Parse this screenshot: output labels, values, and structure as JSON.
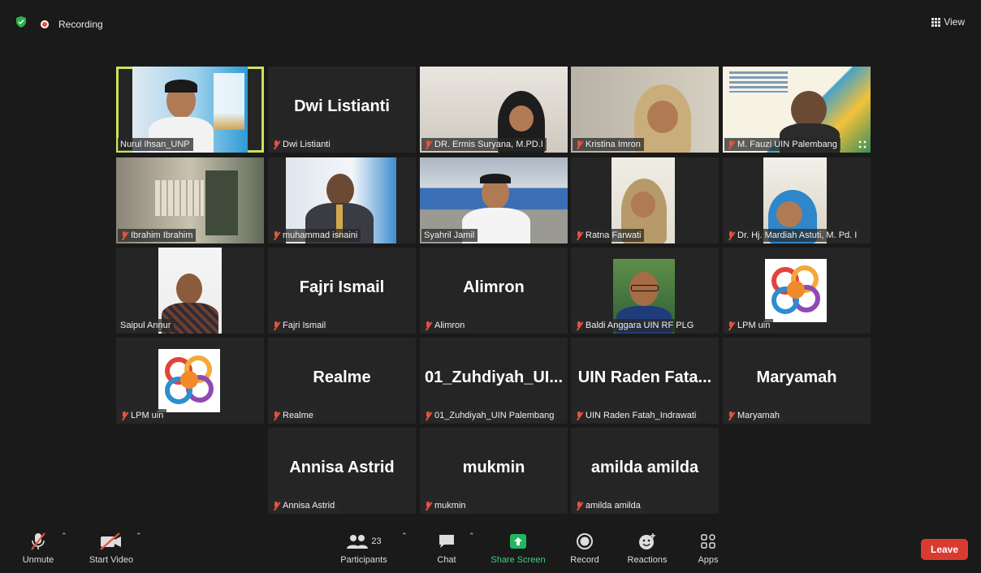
{
  "topbar": {
    "recording_label": "Recording",
    "view_label": "View"
  },
  "colors": {
    "active_speaker": "#c8e65a",
    "leave": "#d93b30",
    "share": "#3dd17f",
    "muted": "#e5533d"
  },
  "tiles": [
    {
      "name": "Nurul Ihsan_UNP",
      "big": "",
      "video": "banner",
      "muted": false
    },
    {
      "name": "Dwi Listianti",
      "big": "Dwi Listianti",
      "muted": true
    },
    {
      "name": "DR. Ermis Suryana, M.PD.I",
      "big": "",
      "video": "hijab-office",
      "muted": true
    },
    {
      "name": "Kristina Imron",
      "big": "",
      "video": "hijab-room",
      "muted": true
    },
    {
      "name": "M. Fauzi UIN Palembang",
      "big": "",
      "video": "poster",
      "muted": true
    },
    {
      "name": "Ibrahim Ibrahim",
      "big": "",
      "video": "office",
      "muted": true
    },
    {
      "name": "muhammad isnaini",
      "big": "",
      "video": "suit",
      "muted": true
    },
    {
      "name": "Syahril Jamil",
      "big": "",
      "video": "outdoor",
      "muted": false
    },
    {
      "name": "Ratna Farwati",
      "big": "",
      "video": "hijab-portrait",
      "muted": true
    },
    {
      "name": "Dr. Hj. Mardiah Astuti, M. Pd. I",
      "big": "",
      "video": "hijab-blue",
      "muted": true
    },
    {
      "name": "Saipul Annur",
      "big": "",
      "video": "batik",
      "muted": false
    },
    {
      "name": "Fajri Ismail",
      "big": "Fajri Ismail",
      "muted": true
    },
    {
      "name": "Alimron",
      "big": "Alimron",
      "muted": true
    },
    {
      "name": "Baldi Anggara UIN RF PLG",
      "big": "",
      "video": "glasses",
      "muted": true
    },
    {
      "name": "LPM uin",
      "big": "",
      "video": "logo",
      "muted": true
    },
    {
      "name": "LPM uin",
      "big": "",
      "video": "logo",
      "muted": true
    },
    {
      "name": "Realme",
      "big": "Realme",
      "muted": true
    },
    {
      "name": "01_Zuhdiyah_UIN Palembang",
      "big": "01_Zuhdiyah_UI...",
      "muted": true
    },
    {
      "name": "UIN Raden Fatah_Indrawati",
      "big": "UIN Raden Fata...",
      "muted": true
    },
    {
      "name": "Maryamah",
      "big": "Maryamah",
      "muted": true
    },
    {
      "name": "Annisa Astrid",
      "big": "Annisa Astrid",
      "muted": true
    },
    {
      "name": "mukmin",
      "big": "mukmin",
      "muted": true
    },
    {
      "name": "amilda amilda",
      "big": "amilda amilda",
      "muted": true
    }
  ],
  "toolbar": {
    "unmute": "Unmute",
    "start_video": "Start Video",
    "participants": "Participants",
    "participants_count": "23",
    "chat": "Chat",
    "share_screen": "Share Screen",
    "record": "Record",
    "reactions": "Reactions",
    "apps": "Apps",
    "leave": "Leave"
  }
}
